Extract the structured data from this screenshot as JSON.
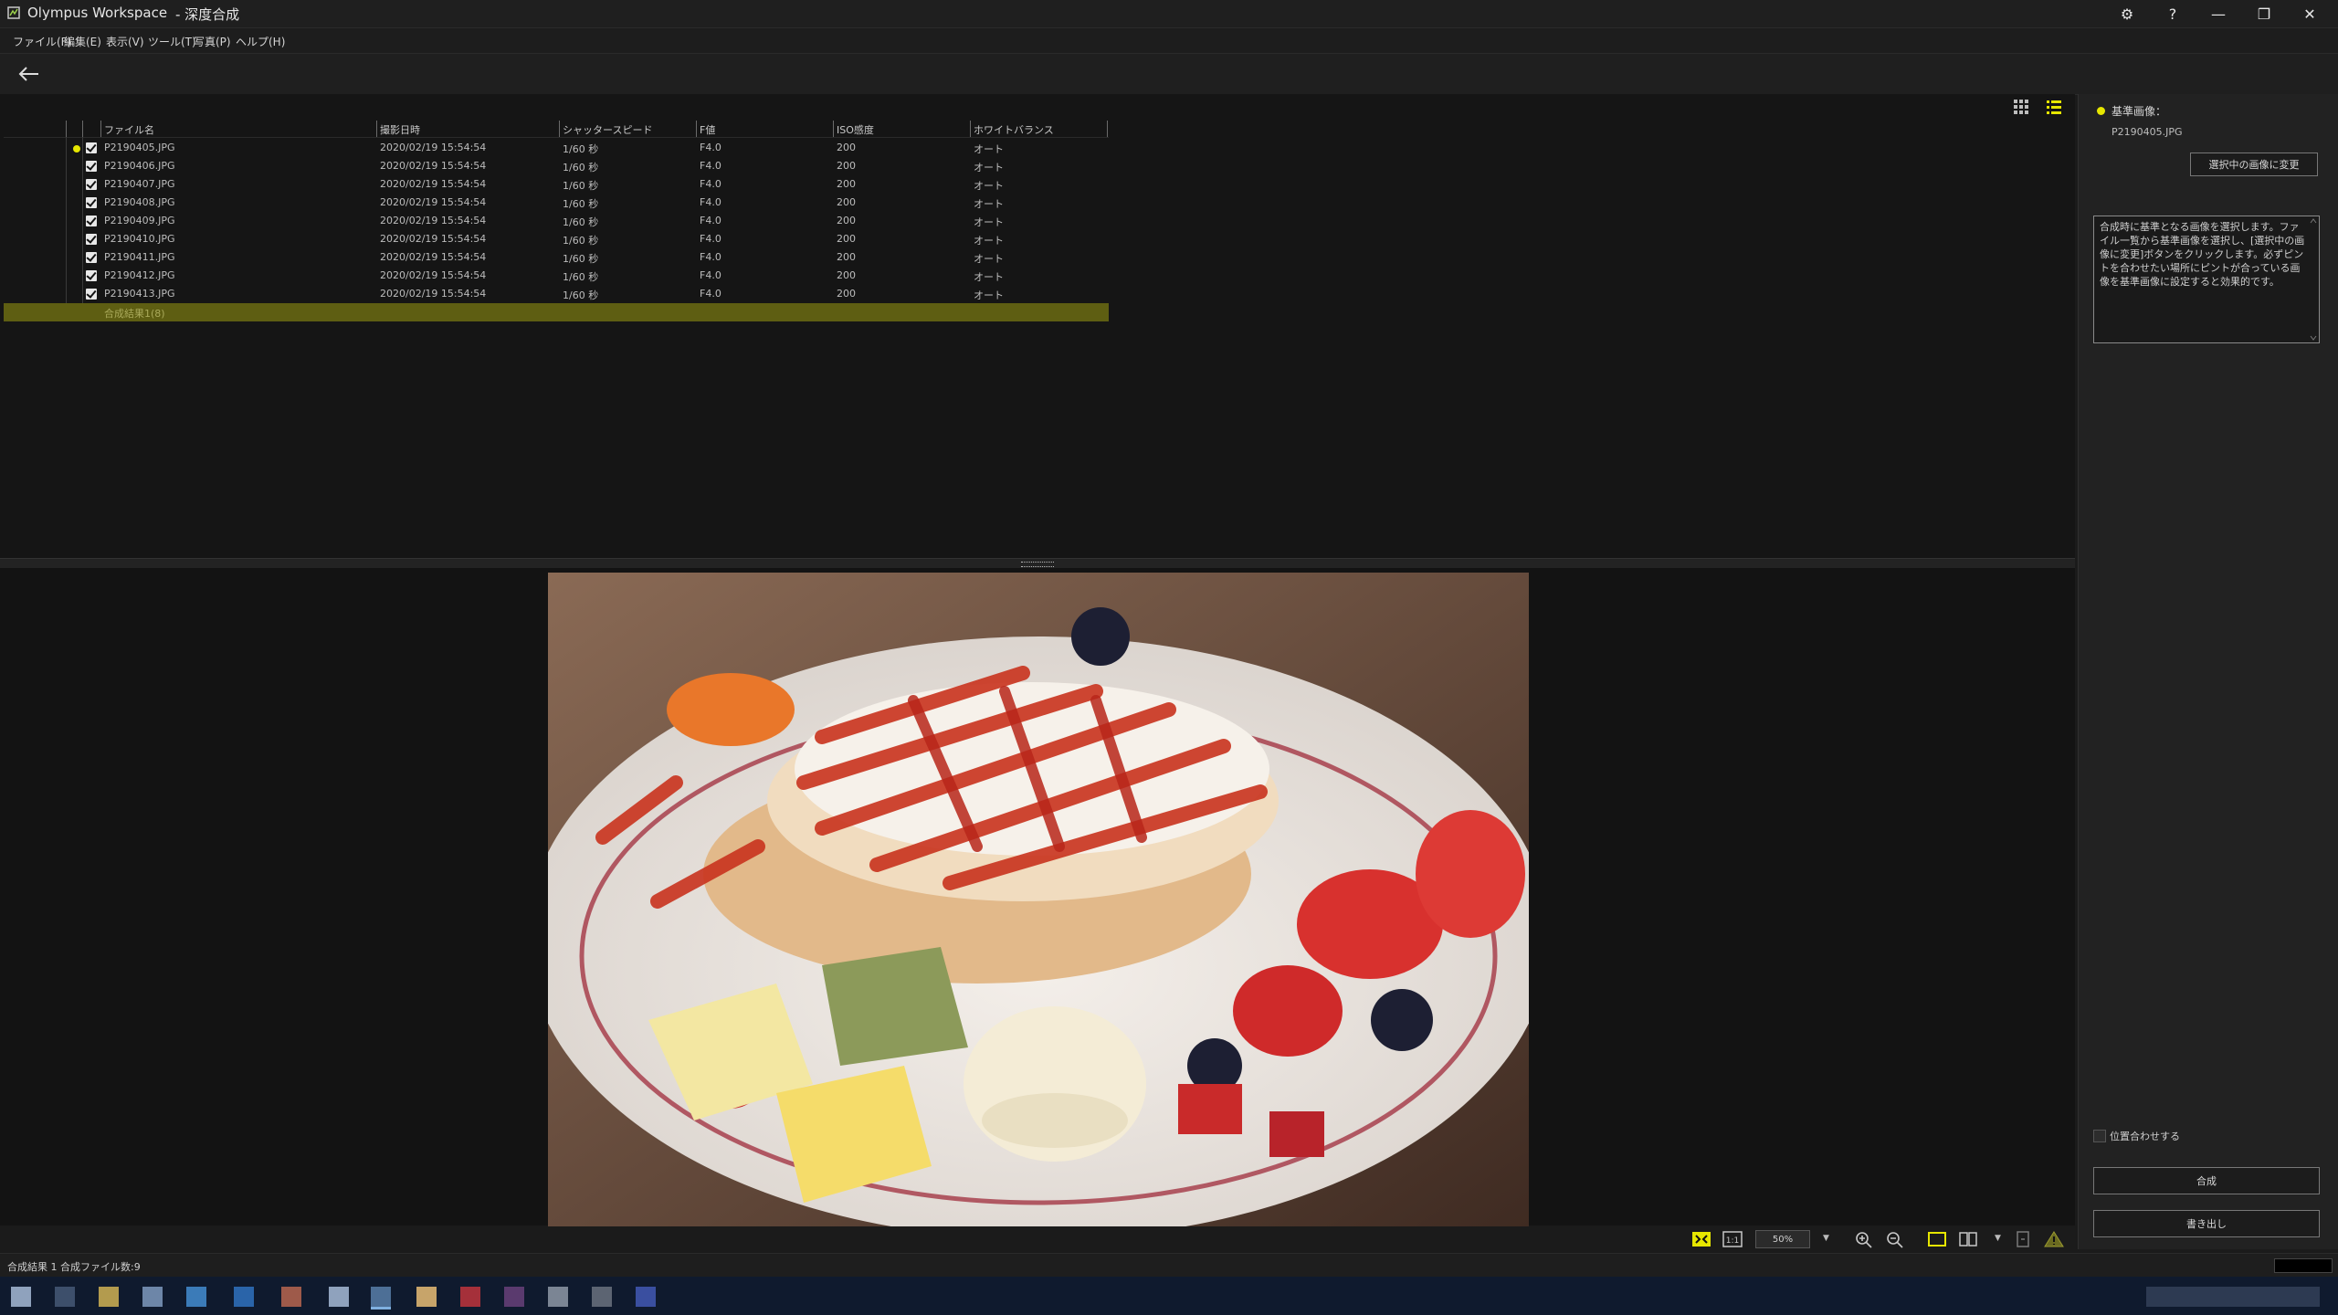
{
  "window": {
    "app_name": "Olympus Workspace",
    "mode_title": "- 深度合成"
  },
  "menu": [
    "ファイル(F)",
    "編集(E)",
    "表示(V)",
    "ツール(T)",
    "写真(P)",
    "ヘルプ(H)"
  ],
  "table": {
    "headers": [
      "ファイル名",
      "撮影日時",
      "シャッタースピード",
      "F値",
      "ISO感度",
      "ホワイトバランス"
    ],
    "rows": [
      {
        "file": "P2190405.JPG",
        "date": "2020/02/19 15:54:54",
        "shutter": "1/60 秒",
        "f": "F4.0",
        "iso": "200",
        "wb": "オート",
        "checked": true,
        "base": true
      },
      {
        "file": "P2190406.JPG",
        "date": "2020/02/19 15:54:54",
        "shutter": "1/60 秒",
        "f": "F4.0",
        "iso": "200",
        "wb": "オート",
        "checked": true
      },
      {
        "file": "P2190407.JPG",
        "date": "2020/02/19 15:54:54",
        "shutter": "1/60 秒",
        "f": "F4.0",
        "iso": "200",
        "wb": "オート",
        "checked": true
      },
      {
        "file": "P2190408.JPG",
        "date": "2020/02/19 15:54:54",
        "shutter": "1/60 秒",
        "f": "F4.0",
        "iso": "200",
        "wb": "オート",
        "checked": true
      },
      {
        "file": "P2190409.JPG",
        "date": "2020/02/19 15:54:54",
        "shutter": "1/60 秒",
        "f": "F4.0",
        "iso": "200",
        "wb": "オート",
        "checked": true
      },
      {
        "file": "P2190410.JPG",
        "date": "2020/02/19 15:54:54",
        "shutter": "1/60 秒",
        "f": "F4.0",
        "iso": "200",
        "wb": "オート",
        "checked": true
      },
      {
        "file": "P2190411.JPG",
        "date": "2020/02/19 15:54:54",
        "shutter": "1/60 秒",
        "f": "F4.0",
        "iso": "200",
        "wb": "オート",
        "checked": true
      },
      {
        "file": "P2190412.JPG",
        "date": "2020/02/19 15:54:54",
        "shutter": "1/60 秒",
        "f": "F4.0",
        "iso": "200",
        "wb": "オート",
        "checked": true
      },
      {
        "file": "P2190413.JPG",
        "date": "2020/02/19 15:54:54",
        "shutter": "1/60 秒",
        "f": "F4.0",
        "iso": "200",
        "wb": "オート",
        "checked": true
      }
    ],
    "result_row_label": "合成結果1(8)"
  },
  "right_panel": {
    "ref_label": "基準画像：",
    "ref_file": "P2190405.JPG",
    "change_button": "選択中の画像に変更",
    "help_text": "合成時に基準となる画像を選択します。ファイル一覧から基準画像を選択し、[選択中の画像に変更]ボタンをクリックします。必ずピントを合わせたい場所にピントが合っている画像を基準画像に設定すると効果的です。",
    "align_label": "位置合わせする",
    "compose_button": "合成",
    "export_button": "書き出し"
  },
  "preview_toolbar": {
    "zoom_value": "50%"
  },
  "status": {
    "text": "合成結果 1  合成ファイル数:9"
  },
  "colors": {
    "accent_yellow": "#e6e600",
    "result_row": "#5e5e12",
    "view_list_active": "#e6e600"
  }
}
